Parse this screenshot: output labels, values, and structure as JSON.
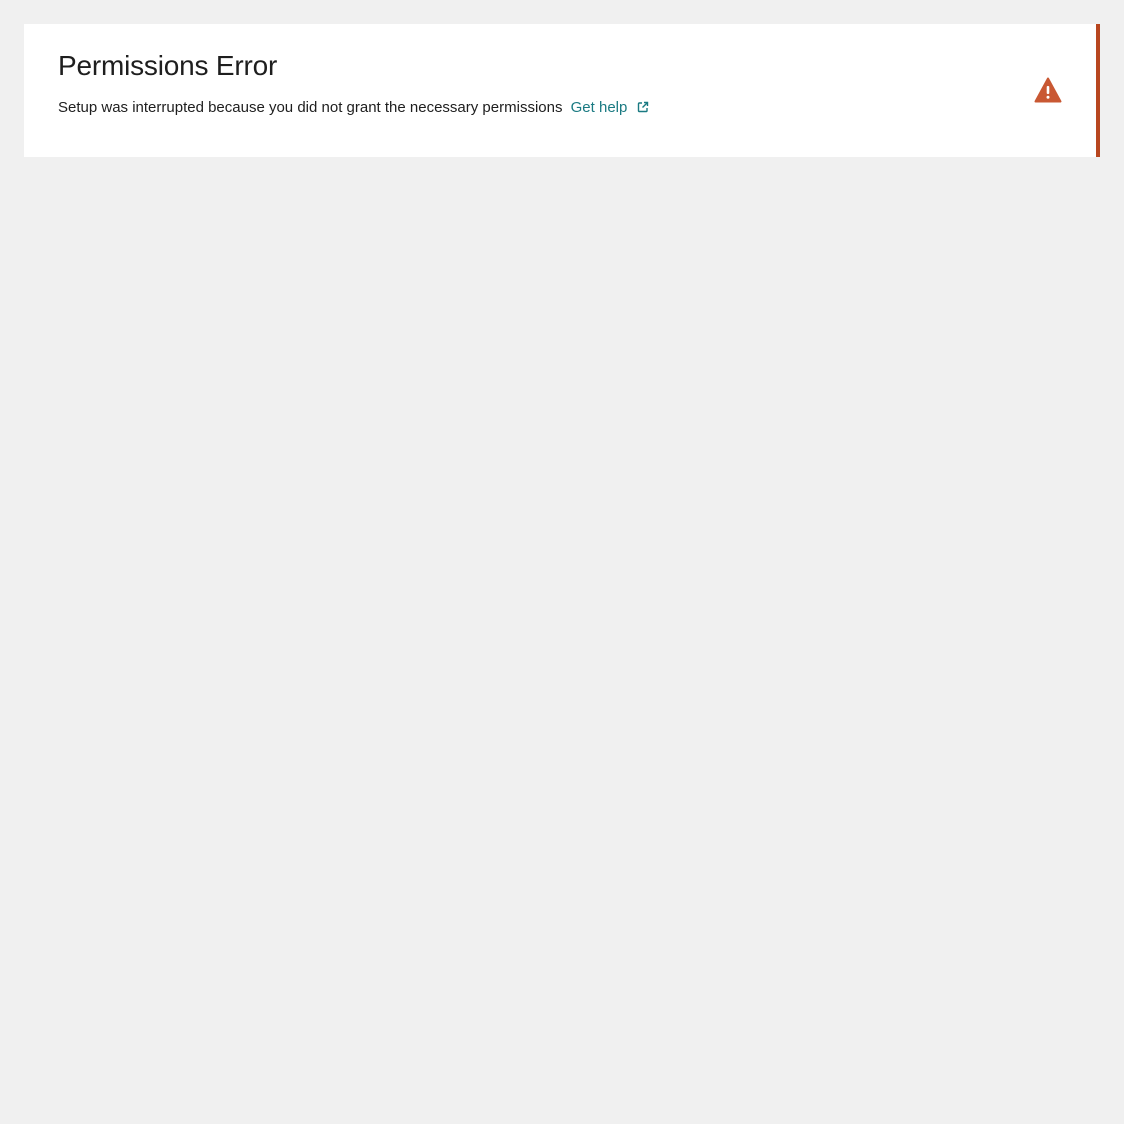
{
  "notice": {
    "title": "Permissions Error",
    "message": "Setup was interrupted because you did not grant the necessary permissions",
    "link_label": "Get help",
    "link_icon": "external-link-icon",
    "status_icon": "warning-triangle-icon",
    "accent_color": "#b8461f",
    "link_color": "#1a7a82"
  }
}
